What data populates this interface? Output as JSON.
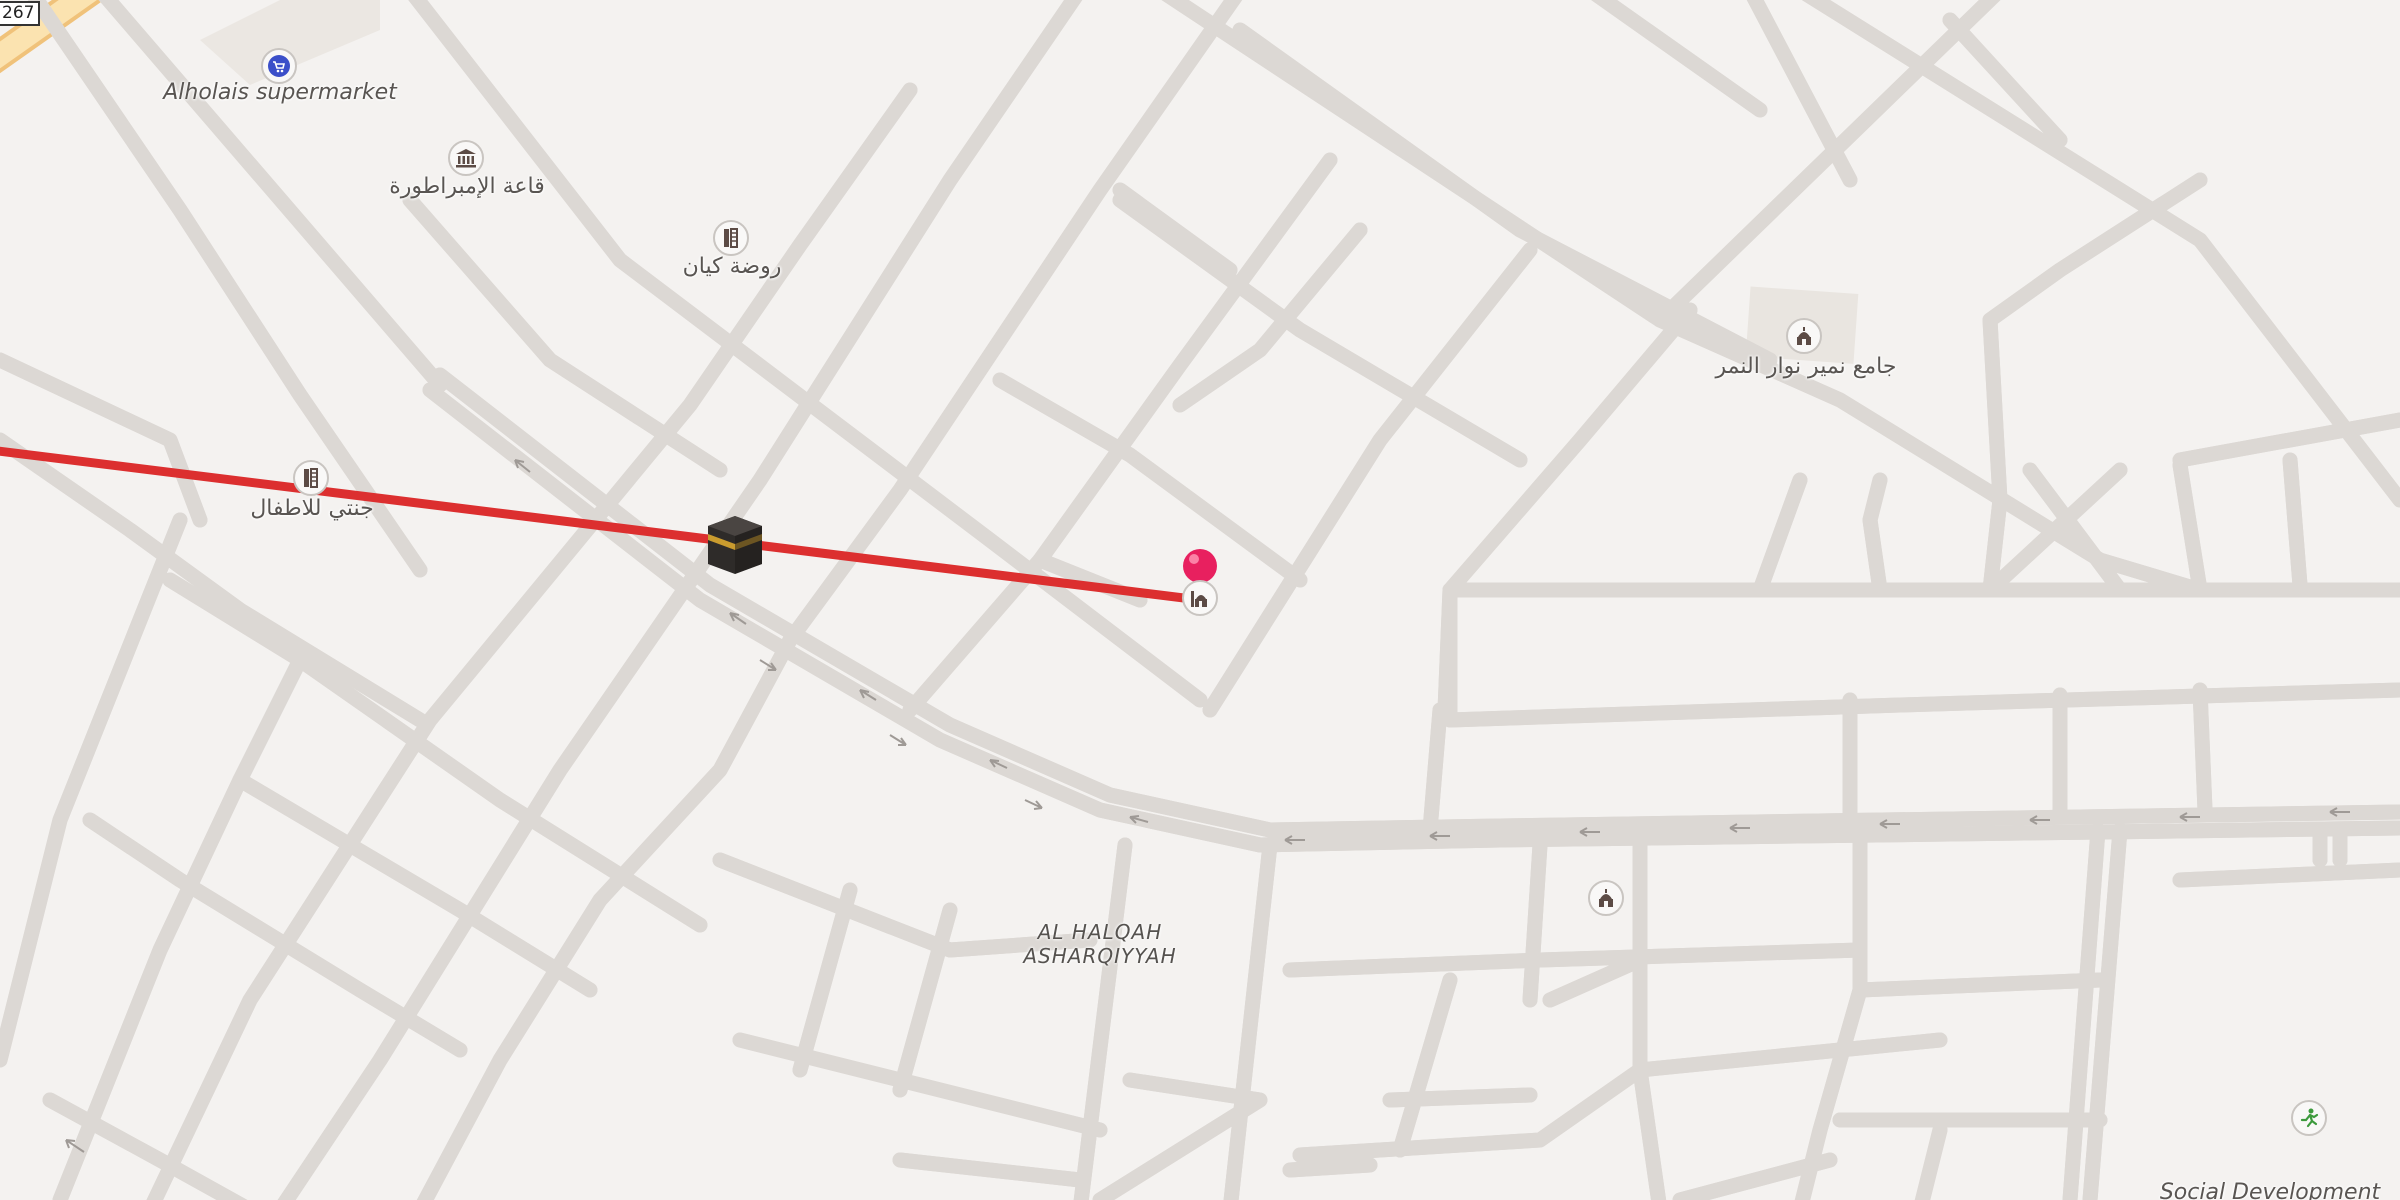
{
  "map": {
    "route_shield": "267",
    "route_line_color": "#dc2f2f",
    "pin_color": "#e8205f",
    "pois": [
      {
        "id": "supermarket",
        "label": "Alholais supermarket",
        "icon": "shopping-cart-icon",
        "italic": true
      },
      {
        "id": "hall",
        "label": "قاعة الإمبراطورة",
        "icon": "museum-icon",
        "italic": false
      },
      {
        "id": "kindergarten1",
        "label": "روضة كيان",
        "icon": "school-icon",
        "italic": false
      },
      {
        "id": "kindergarten2",
        "label": "جنتي للاطفال",
        "icon": "school-icon",
        "italic": false
      },
      {
        "id": "mosque1",
        "label": "جامع نمير نوار النمر",
        "icon": "mosque-icon",
        "italic": false
      },
      {
        "id": "mosque2",
        "label": "",
        "icon": "mosque-icon",
        "italic": false
      },
      {
        "id": "sport",
        "label": "",
        "icon": "running-icon",
        "italic": false
      }
    ],
    "district_line1": "AL HALQAH",
    "district_line2": "ASHARQIYYAH",
    "bottom_label": "Social Development"
  }
}
